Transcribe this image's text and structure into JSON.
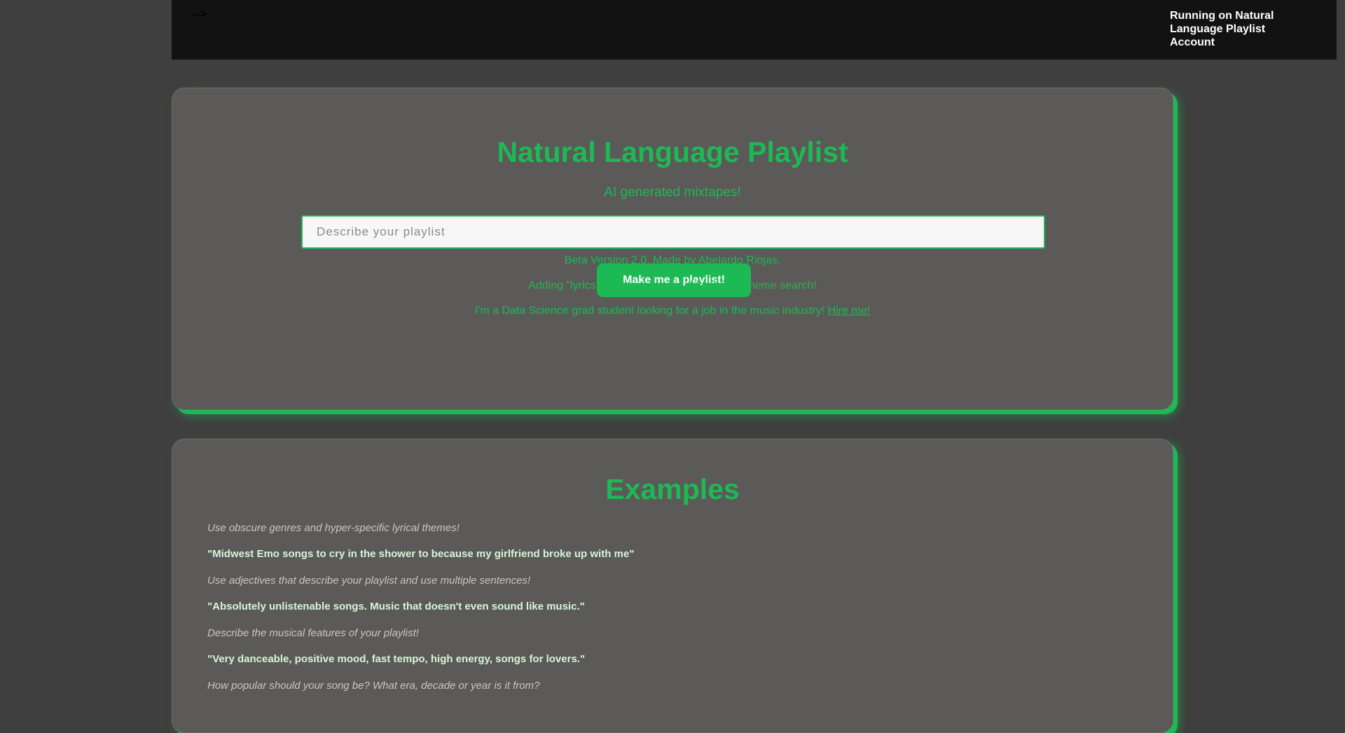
{
  "topbar": {
    "stray_text": "-->",
    "account_text": "Running on Natural Language Playlist Account"
  },
  "hero": {
    "title": "Natural Language Playlist",
    "subtitle": "AI generated mixtapes!",
    "search_placeholder": "Describe your playlist",
    "search_value": "",
    "button_label": "Make me a playlist!",
    "note_version": "Beta Version 2.0. Made by Abelardo Riojas.",
    "note_lyrics": "Adding \"lyrics\" to your query enables lyrical theme search!",
    "note_job": "I'm a Data Science grad student looking for a job in the music industry! ",
    "hire_link": "Hire me!"
  },
  "examples": {
    "title": "Examples",
    "items": [
      {
        "hint": "Use obscure genres and hyper-specific lyrical themes!",
        "example": "\"Midwest Emo songs to cry in the shower to because my girlfriend broke up with me\""
      },
      {
        "hint": "Use adjectives that describe your playlist and use multiple sentences!",
        "example": "\"Absolutely unlistenable songs. Music that doesn't even sound like music.\""
      },
      {
        "hint": "Describe the musical features of your playlist!",
        "example": "\"Very danceable, positive mood, fast tempo, high energy, songs for lovers.\""
      },
      {
        "hint": "How popular should your song be? What era, decade or year is it from?"
      }
    ]
  }
}
